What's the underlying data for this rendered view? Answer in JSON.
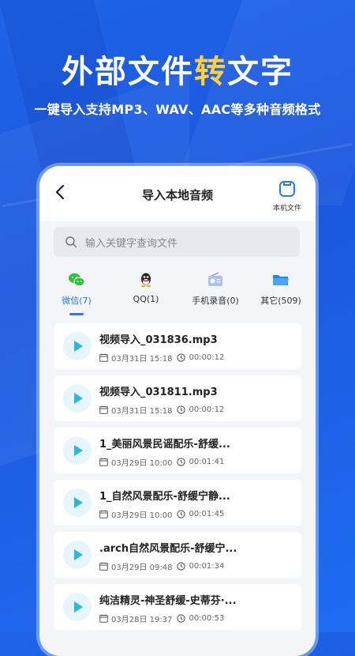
{
  "hero": {
    "title_part1": "外部文件",
    "title_highlight": "转",
    "title_part2": "文字",
    "subtitle": "一键导入支持MP3、WAV、AAC等多种音频格式"
  },
  "header": {
    "title": "导入本地音频",
    "local_files_label": "本机文件"
  },
  "search": {
    "placeholder": "输入关键字查询文件"
  },
  "tabs": [
    {
      "label": "微信(7)",
      "icon": "wechat-icon",
      "active": true
    },
    {
      "label": "QQ(1)",
      "icon": "qq-icon",
      "active": false
    },
    {
      "label": "手机录音(0)",
      "icon": "radio-icon",
      "active": false
    },
    {
      "label": "其它(509)",
      "icon": "folder-icon",
      "active": false
    }
  ],
  "files": [
    {
      "name": "视频导入_031836.mp3",
      "date": "03月31日 15:18",
      "duration": "00:00:12"
    },
    {
      "name": "视频导入_031811.mp3",
      "date": "03月31日 15:18",
      "duration": "00:00:12"
    },
    {
      "name": "1_美丽风景民谣配乐-舒缓...",
      "date": "03月29日 10:00",
      "duration": "00:01:41"
    },
    {
      "name": "1_自然风景配乐-舒缓宁静...",
      "date": "03月29日 10:00",
      "duration": "00:01:45"
    },
    {
      "name": ".arch自然风景配乐-舒缓宁...",
      "date": "03月29日 09:48",
      "duration": "00:01:34"
    },
    {
      "name": "纯洁精灵-神圣舒缓-史蒂芬·...",
      "date": "03月28日 19:37",
      "duration": "00:00:53"
    }
  ],
  "colors": {
    "accent": "#2b79f0",
    "highlight": "#ffd23a",
    "background": "#1e63e8"
  }
}
